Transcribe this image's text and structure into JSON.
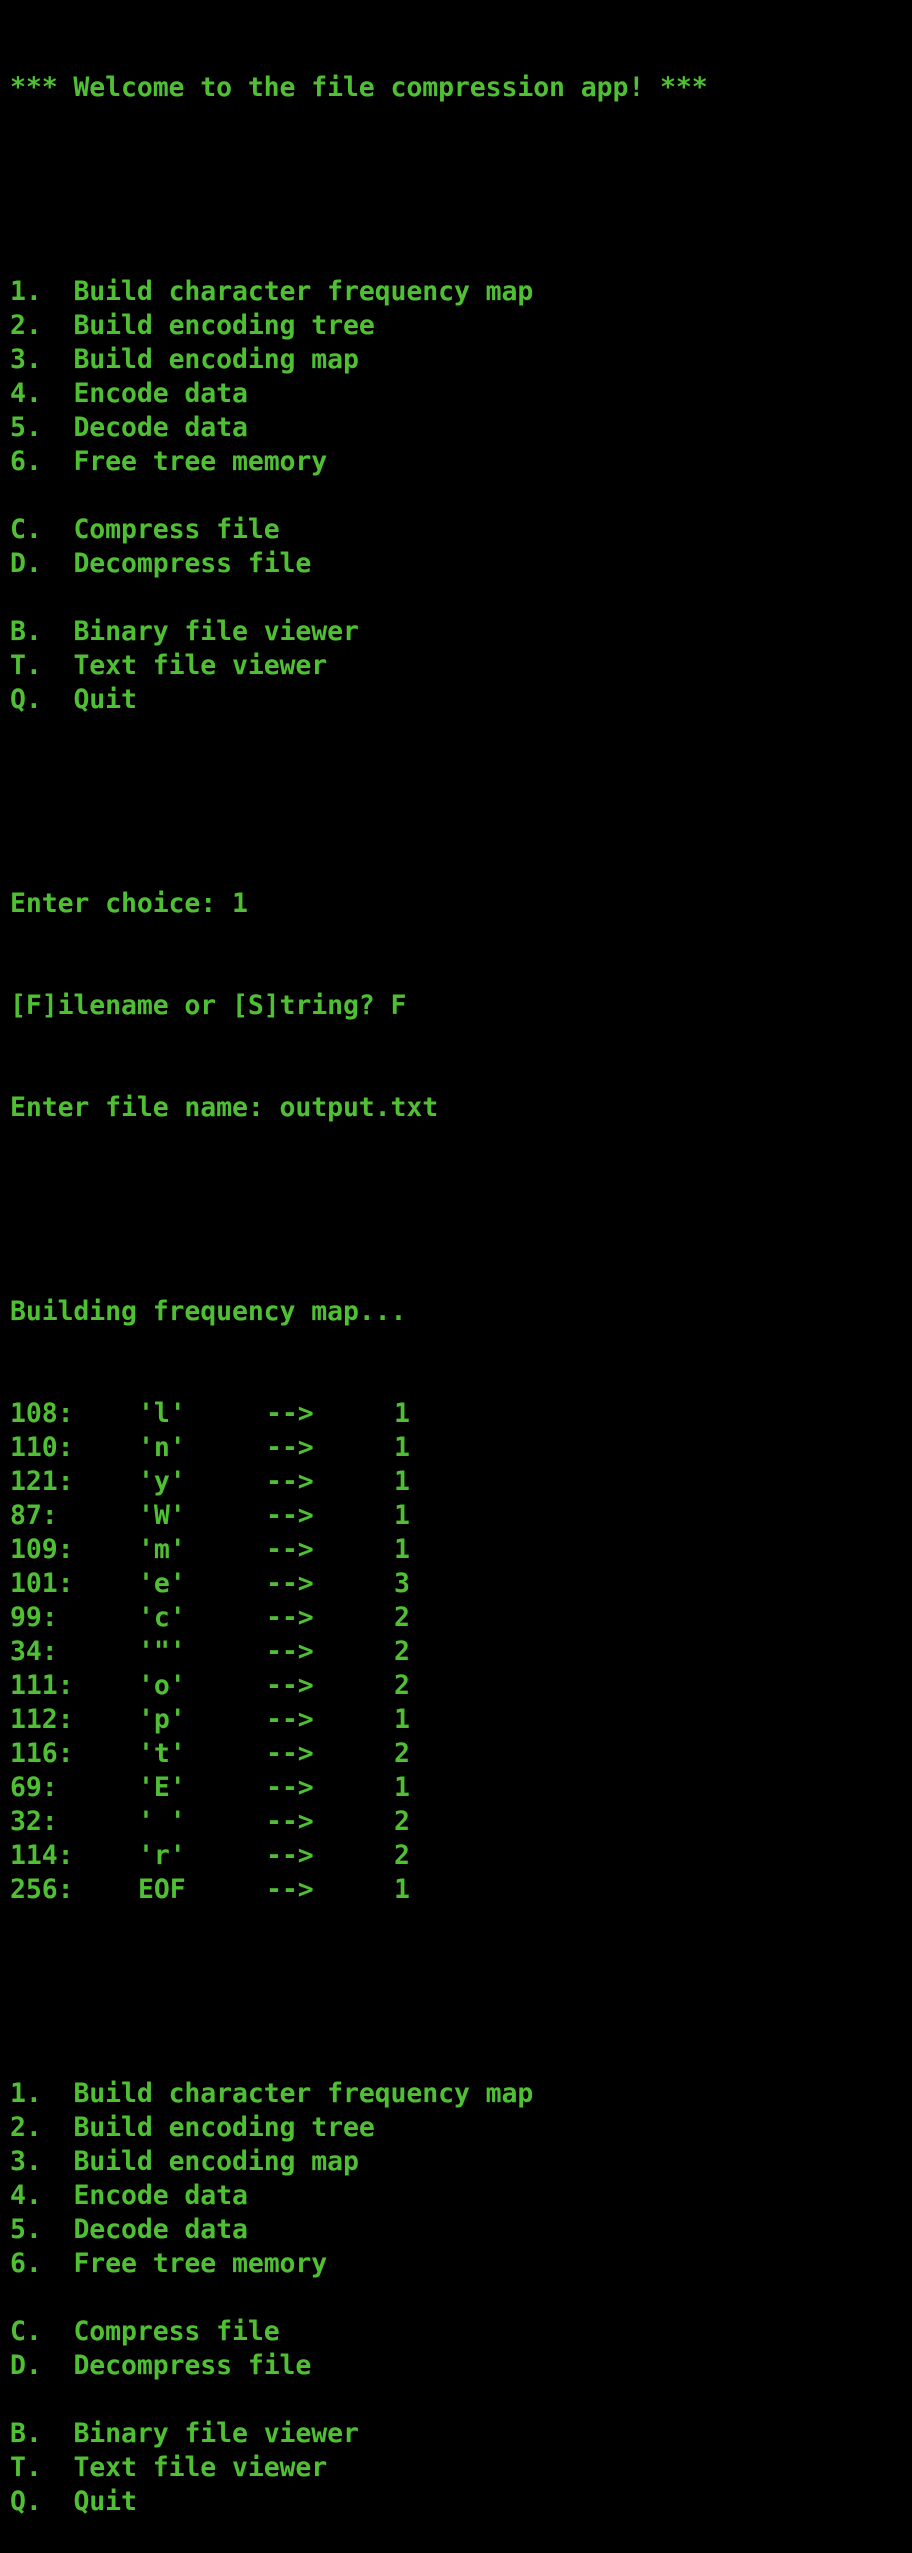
{
  "theme": {
    "background": "#000000",
    "foreground": "#4fc033"
  },
  "welcome": "*** Welcome to the file compression app! ***",
  "menu": [
    {
      "key": "1.",
      "label": "Build character frequency map"
    },
    {
      "key": "2.",
      "label": "Build encoding tree"
    },
    {
      "key": "3.",
      "label": "Build encoding map"
    },
    {
      "key": "4.",
      "label": "Encode data"
    },
    {
      "key": "5.",
      "label": "Decode data"
    },
    {
      "key": "6.",
      "label": "Free tree memory"
    },
    null,
    {
      "key": "C.",
      "label": "Compress file"
    },
    {
      "key": "D.",
      "label": "Decompress file"
    },
    null,
    {
      "key": "B.",
      "label": "Binary file viewer"
    },
    {
      "key": "T.",
      "label": "Text file viewer"
    },
    {
      "key": "Q.",
      "label": "Quit"
    }
  ],
  "session": {
    "choice_prompt": "Enter choice: 1",
    "source_prompt": "[F]ilename or [S]tring? F",
    "file_prompt": "Enter file name: output.txt",
    "building": "Building frequency map..."
  },
  "frequency_map": [
    {
      "code": "108:",
      "char": "'l'",
      "arrow": "-->",
      "count": "1"
    },
    {
      "code": "110:",
      "char": "'n'",
      "arrow": "-->",
      "count": "1"
    },
    {
      "code": "121:",
      "char": "'y'",
      "arrow": "-->",
      "count": "1"
    },
    {
      "code": "87:",
      "char": "'W'",
      "arrow": "-->",
      "count": "1"
    },
    {
      "code": "109:",
      "char": "'m'",
      "arrow": "-->",
      "count": "1"
    },
    {
      "code": "101:",
      "char": "'e'",
      "arrow": "-->",
      "count": "3"
    },
    {
      "code": "99:",
      "char": "'c'",
      "arrow": "-->",
      "count": "2"
    },
    {
      "code": "34:",
      "char": "'\"'",
      "arrow": "-->",
      "count": "2"
    },
    {
      "code": "111:",
      "char": "'o'",
      "arrow": "-->",
      "count": "2"
    },
    {
      "code": "112:",
      "char": "'p'",
      "arrow": "-->",
      "count": "1"
    },
    {
      "code": "116:",
      "char": "'t'",
      "arrow": "-->",
      "count": "2"
    },
    {
      "code": "69:",
      "char": "'E'",
      "arrow": "-->",
      "count": "1"
    },
    {
      "code": "32:",
      "char": "' '",
      "arrow": "-->",
      "count": "2"
    },
    {
      "code": "114:",
      "char": "'r'",
      "arrow": "-->",
      "count": "2"
    },
    {
      "code": "256:",
      "char": "EOF",
      "arrow": "-->",
      "count": "1"
    }
  ]
}
